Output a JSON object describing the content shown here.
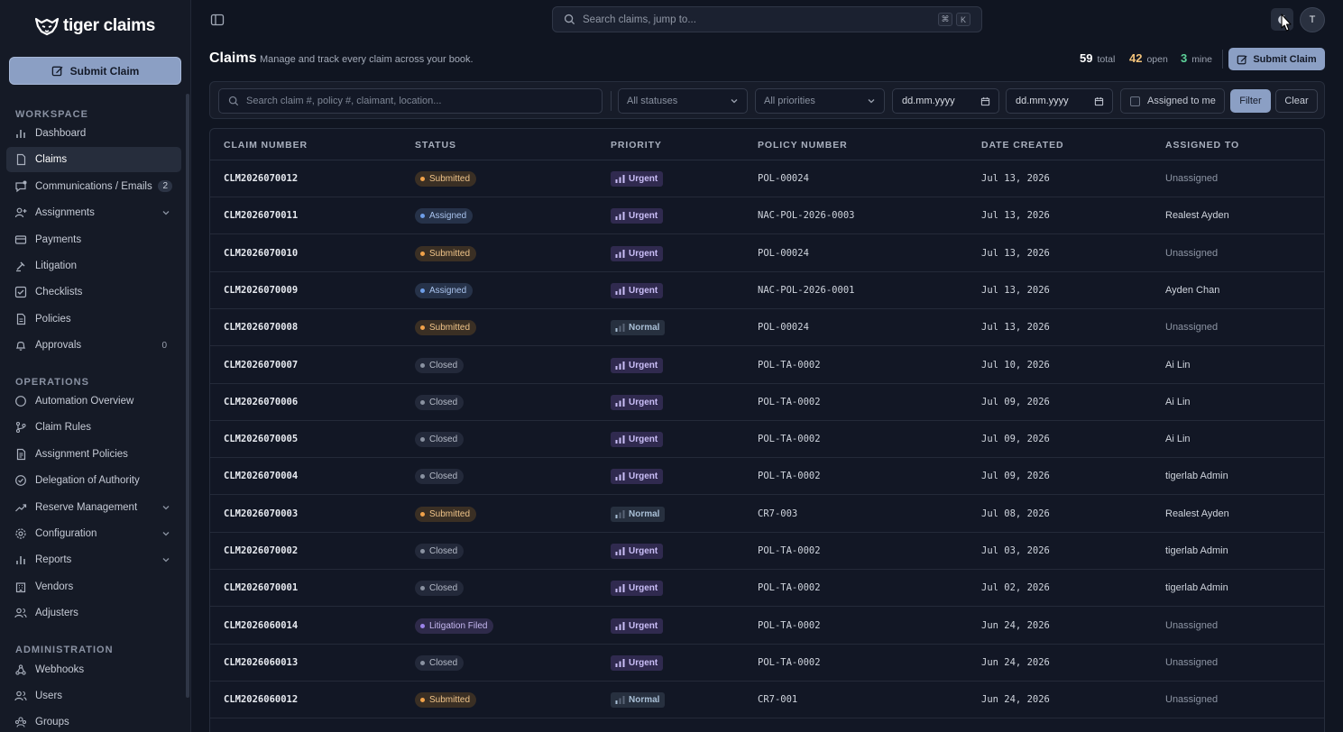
{
  "app": {
    "logo_text": "tiger claims",
    "submit_claim_label": "Submit Claim"
  },
  "sidebar": {
    "sections": [
      {
        "label": "WORKSPACE"
      },
      {
        "label": "OPERATIONS"
      },
      {
        "label": "ADMINISTRATION"
      }
    ],
    "workspace": [
      {
        "label": "Dashboard",
        "icon": "bar-chart-icon"
      },
      {
        "label": "Claims",
        "icon": "document-icon",
        "active": true
      },
      {
        "label": "Communications / Emails",
        "icon": "message-icon",
        "badge": "2"
      },
      {
        "label": "Assignments",
        "icon": "user-plus-icon",
        "expandable": true
      },
      {
        "label": "Payments",
        "icon": "credit-card-icon"
      },
      {
        "label": "Litigation",
        "icon": "gavel-icon"
      },
      {
        "label": "Checklists",
        "icon": "checklist-icon"
      },
      {
        "label": "Policies",
        "icon": "policy-icon"
      },
      {
        "label": "Approvals",
        "icon": "bell-icon",
        "count": "0"
      }
    ],
    "operations": [
      {
        "label": "Automation Overview",
        "icon": "circle-icon"
      },
      {
        "label": "Claim Rules",
        "icon": "git-branch-icon"
      },
      {
        "label": "Assignment Policies",
        "icon": "file-text-icon"
      },
      {
        "label": "Delegation of Authority",
        "icon": "check-circle-icon"
      },
      {
        "label": "Reserve Management",
        "icon": "trending-up-icon",
        "expandable": true
      },
      {
        "label": "Configuration",
        "icon": "gear-icon",
        "expandable": true
      },
      {
        "label": "Reports",
        "icon": "bar-chart-icon",
        "expandable": true
      },
      {
        "label": "Vendors",
        "icon": "building-icon"
      },
      {
        "label": "Adjusters",
        "icon": "users-icon"
      }
    ],
    "administration": [
      {
        "label": "Webhooks",
        "icon": "webhook-icon"
      },
      {
        "label": "Users",
        "icon": "users-icon"
      },
      {
        "label": "Groups",
        "icon": "groups-icon"
      }
    ]
  },
  "topbar": {
    "search_placeholder": "Search claims, jump to...",
    "shortcut_keys": [
      "⌘",
      "K"
    ],
    "avatar_initial": "T"
  },
  "page": {
    "title": "Claims",
    "subtitle": "Manage and track every claim across your book.",
    "stats": {
      "total": {
        "value": "59",
        "label": "total",
        "color": "#ffffff"
      },
      "open": {
        "value": "42",
        "label": "open",
        "color": "#f2c27a"
      },
      "mine": {
        "value": "3",
        "label": "mine",
        "color": "#5ed29a"
      }
    },
    "submit_label": "Submit Claim"
  },
  "filters": {
    "search_placeholder": "Search claim #, policy #, claimant, location...",
    "status_value": "All statuses",
    "priority_value": "All priorities",
    "date_from": "dd.mm.yyyy",
    "date_to": "dd.mm.yyyy",
    "assigned_to_me_label": "Assigned to me",
    "filter_label": "Filter",
    "clear_label": "Clear"
  },
  "table": {
    "columns": [
      "CLAIM NUMBER",
      "STATUS",
      "PRIORITY",
      "POLICY NUMBER",
      "DATE CREATED",
      "ASSIGNED TO"
    ],
    "rows": [
      {
        "claim": "CLM2026070012",
        "status": "Submitted",
        "priority": "Urgent",
        "policy": "POL-00024",
        "date": "Jul 13, 2026",
        "assignee": "Unassigned"
      },
      {
        "claim": "CLM2026070011",
        "status": "Assigned",
        "priority": "Urgent",
        "policy": "NAC-POL-2026-0003",
        "date": "Jul 13, 2026",
        "assignee": "Realest Ayden"
      },
      {
        "claim": "CLM2026070010",
        "status": "Submitted",
        "priority": "Urgent",
        "policy": "POL-00024",
        "date": "Jul 13, 2026",
        "assignee": "Unassigned"
      },
      {
        "claim": "CLM2026070009",
        "status": "Assigned",
        "priority": "Urgent",
        "policy": "NAC-POL-2026-0001",
        "date": "Jul 13, 2026",
        "assignee": "Ayden Chan"
      },
      {
        "claim": "CLM2026070008",
        "status": "Submitted",
        "priority": "Normal",
        "policy": "POL-00024",
        "date": "Jul 13, 2026",
        "assignee": "Unassigned"
      },
      {
        "claim": "CLM2026070007",
        "status": "Closed",
        "priority": "Urgent",
        "policy": "POL-TA-0002",
        "date": "Jul 10, 2026",
        "assignee": "Ai Lin"
      },
      {
        "claim": "CLM2026070006",
        "status": "Closed",
        "priority": "Urgent",
        "policy": "POL-TA-0002",
        "date": "Jul 09, 2026",
        "assignee": "Ai Lin"
      },
      {
        "claim": "CLM2026070005",
        "status": "Closed",
        "priority": "Urgent",
        "policy": "POL-TA-0002",
        "date": "Jul 09, 2026",
        "assignee": "Ai Lin"
      },
      {
        "claim": "CLM2026070004",
        "status": "Closed",
        "priority": "Urgent",
        "policy": "POL-TA-0002",
        "date": "Jul 09, 2026",
        "assignee": "tigerlab Admin"
      },
      {
        "claim": "CLM2026070003",
        "status": "Submitted",
        "priority": "Normal",
        "policy": "CR7-003",
        "date": "Jul 08, 2026",
        "assignee": "Realest Ayden"
      },
      {
        "claim": "CLM2026070002",
        "status": "Closed",
        "priority": "Urgent",
        "policy": "POL-TA-0002",
        "date": "Jul 03, 2026",
        "assignee": "tigerlab Admin"
      },
      {
        "claim": "CLM2026070001",
        "status": "Closed",
        "priority": "Urgent",
        "policy": "POL-TA-0002",
        "date": "Jul 02, 2026",
        "assignee": "tigerlab Admin"
      },
      {
        "claim": "CLM2026060014",
        "status": "Litigation Filed",
        "priority": "Urgent",
        "policy": "POL-TA-0002",
        "date": "Jun 24, 2026",
        "assignee": "Unassigned"
      },
      {
        "claim": "CLM2026060013",
        "status": "Closed",
        "priority": "Urgent",
        "policy": "POL-TA-0002",
        "date": "Jun 24, 2026",
        "assignee": "Unassigned"
      },
      {
        "claim": "CLM2026060012",
        "status": "Submitted",
        "priority": "Normal",
        "policy": "CR7-001",
        "date": "Jun 24, 2026",
        "assignee": "Unassigned"
      }
    ]
  }
}
